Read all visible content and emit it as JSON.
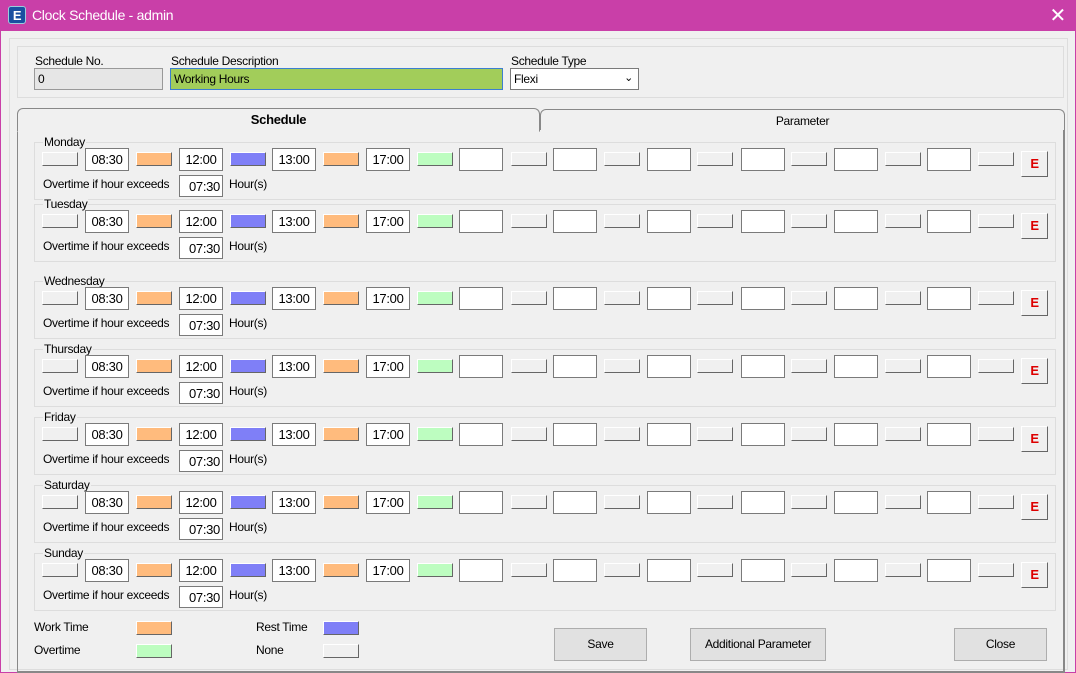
{
  "window": {
    "title": "Clock Schedule - admin",
    "icon": "E",
    "close": "✕"
  },
  "header": {
    "no_label": "Schedule No.",
    "no_value": "0",
    "desc_label": "Schedule Description",
    "desc_value": "Working Hours",
    "type_label": "Schedule Type",
    "type_value": "Flexi"
  },
  "tabs": [
    {
      "label": "Schedule",
      "active": true
    },
    {
      "label": "Parameter",
      "active": false
    }
  ],
  "colors": {
    "work": "#ffbb7d",
    "rest": "#7f7ff7",
    "overtime": "#bdfdc0",
    "none": "#f0f0f0",
    "desc_bg": "#a2cd5a"
  },
  "overtime_label": "Overtime if hour exceeds",
  "hours_label": "Hour(s)",
  "edit_label": "E",
  "days": [
    {
      "name": "Monday",
      "times": [
        "08:30",
        "12:00",
        "13:00",
        "17:00",
        "",
        "",
        "",
        "",
        "",
        ""
      ],
      "segments": [
        "none",
        "work",
        "rest",
        "work",
        "overtime",
        "none",
        "none",
        "none",
        "none",
        "none",
        "none"
      ],
      "overtime": "07:30"
    },
    {
      "name": "Tuesday",
      "times": [
        "08:30",
        "12:00",
        "13:00",
        "17:00",
        "",
        "",
        "",
        "",
        "",
        ""
      ],
      "segments": [
        "none",
        "work",
        "rest",
        "work",
        "overtime",
        "none",
        "none",
        "none",
        "none",
        "none",
        "none"
      ],
      "overtime": "07:30"
    },
    {
      "name": "Wednesday",
      "times": [
        "08:30",
        "12:00",
        "13:00",
        "17:00",
        "",
        "",
        "",
        "",
        "",
        ""
      ],
      "segments": [
        "none",
        "work",
        "rest",
        "work",
        "overtime",
        "none",
        "none",
        "none",
        "none",
        "none",
        "none"
      ],
      "overtime": "07:30"
    },
    {
      "name": "Thursday",
      "times": [
        "08:30",
        "12:00",
        "13:00",
        "17:00",
        "",
        "",
        "",
        "",
        "",
        ""
      ],
      "segments": [
        "none",
        "work",
        "rest",
        "work",
        "overtime",
        "none",
        "none",
        "none",
        "none",
        "none",
        "none"
      ],
      "overtime": "07:30"
    },
    {
      "name": "Friday",
      "times": [
        "08:30",
        "12:00",
        "13:00",
        "17:00",
        "",
        "",
        "",
        "",
        "",
        ""
      ],
      "segments": [
        "none",
        "work",
        "rest",
        "work",
        "overtime",
        "none",
        "none",
        "none",
        "none",
        "none",
        "none"
      ],
      "overtime": "07:30"
    },
    {
      "name": "Saturday",
      "times": [
        "08:30",
        "12:00",
        "13:00",
        "17:00",
        "",
        "",
        "",
        "",
        "",
        ""
      ],
      "segments": [
        "none",
        "work",
        "rest",
        "work",
        "overtime",
        "none",
        "none",
        "none",
        "none",
        "none",
        "none"
      ],
      "overtime": "07:30"
    },
    {
      "name": "Sunday",
      "times": [
        "08:30",
        "12:00",
        "13:00",
        "17:00",
        "",
        "",
        "",
        "",
        "",
        ""
      ],
      "segments": [
        "none",
        "work",
        "rest",
        "work",
        "overtime",
        "none",
        "none",
        "none",
        "none",
        "none",
        "none"
      ],
      "overtime": "07:30"
    }
  ],
  "legend": {
    "work": "Work Time",
    "rest": "Rest Time",
    "overtime": "Overtime",
    "none": "None"
  },
  "buttons": {
    "save": "Save",
    "additional": "Additional Parameter",
    "close": "Close"
  }
}
